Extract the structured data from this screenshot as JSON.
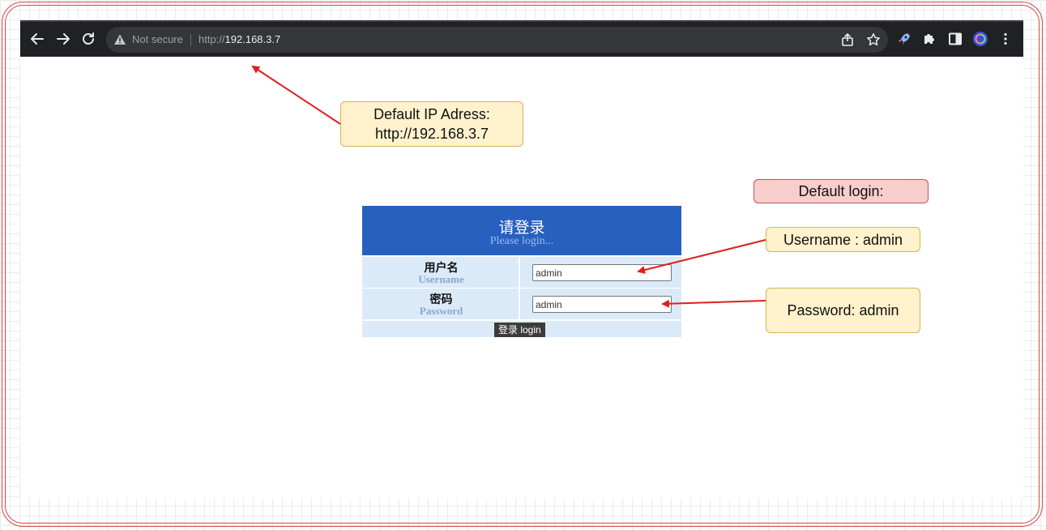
{
  "browser": {
    "security_label": "Not secure",
    "url_scheme": "http://",
    "url_host": "192.168.3.7"
  },
  "callouts": {
    "ip": "Default IP Adress:\nhttp://192.168.3.7",
    "login_heading": "Default login:",
    "username": "Username : admin",
    "password": "Password: admin"
  },
  "login": {
    "title": "请登录",
    "subtitle": "Please login...",
    "username_label_cn": "用户名",
    "username_label_en": "Username",
    "username_value": "admin",
    "password_label_cn": "密码",
    "password_label_en": "Password",
    "password_value": "admin",
    "button_label": "登录 login"
  },
  "colors": {
    "toolbar": "#202124",
    "login_header": "#2760bf",
    "login_row": "#dbeaf8",
    "callout_yellow": "#fff2cc",
    "callout_pink": "#f8cecc",
    "arrow": "#e01e1e"
  },
  "icons": {
    "back": "back-arrow-icon",
    "forward": "forward-arrow-icon",
    "reload": "reload-icon",
    "warning": "warning-triangle-icon",
    "share": "share-icon",
    "bookmark": "star-icon",
    "rocket": "rocket-extension-icon",
    "extensions": "puzzle-icon",
    "side_panel": "side-panel-icon",
    "profile": "profile-avatar-icon",
    "menu": "kebab-menu-icon"
  }
}
